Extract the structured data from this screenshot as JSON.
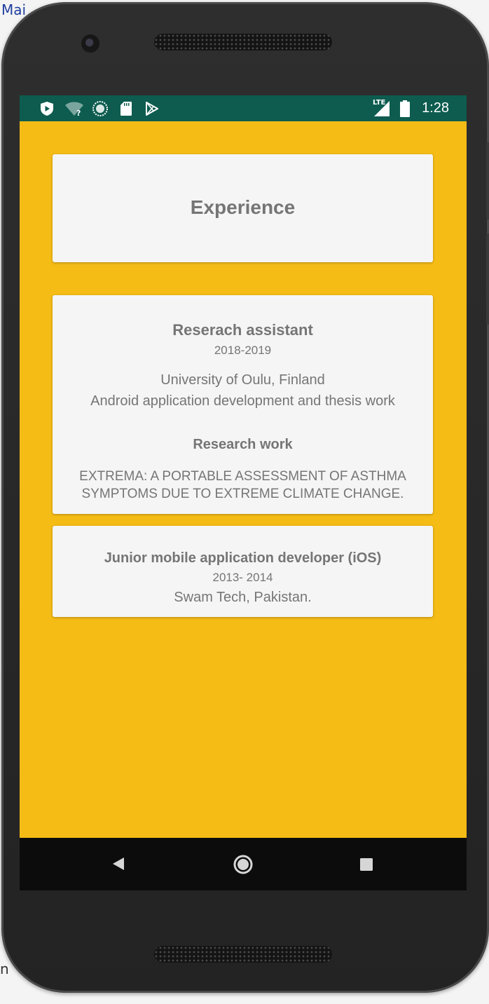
{
  "desktop": {
    "top_text": "Mai",
    "bottom_text": "n"
  },
  "status_bar": {
    "time": "1:28",
    "network_label": "LTE",
    "left_icons": [
      "shield-icon",
      "wifi-unknown-icon",
      "sync-circle-icon",
      "sd-card-icon",
      "play-store-icon"
    ],
    "bg_color": "#0d5c4f"
  },
  "page": {
    "bg_color": "#f5bc16",
    "title": "Experience",
    "experiences": [
      {
        "role": "Reserach assistant",
        "years": "2018-2019",
        "organization": "University of Oulu, Finland",
        "description": "Android application development and thesis work",
        "research_heading": "Research work",
        "research_line1": "EXTREMA: A PORTABLE ASSESSMENT OF ASTHMA",
        "research_line2": "SYMPTOMS DUE TO EXTREME CLIMATE CHANGE."
      },
      {
        "role": "Junior mobile application developer (iOS)",
        "years": "2013- 2014",
        "organization": "Swam Tech, Pakistan."
      }
    ]
  },
  "nav_bar": {
    "buttons": [
      "back-icon",
      "home-icon",
      "recents-icon"
    ]
  }
}
